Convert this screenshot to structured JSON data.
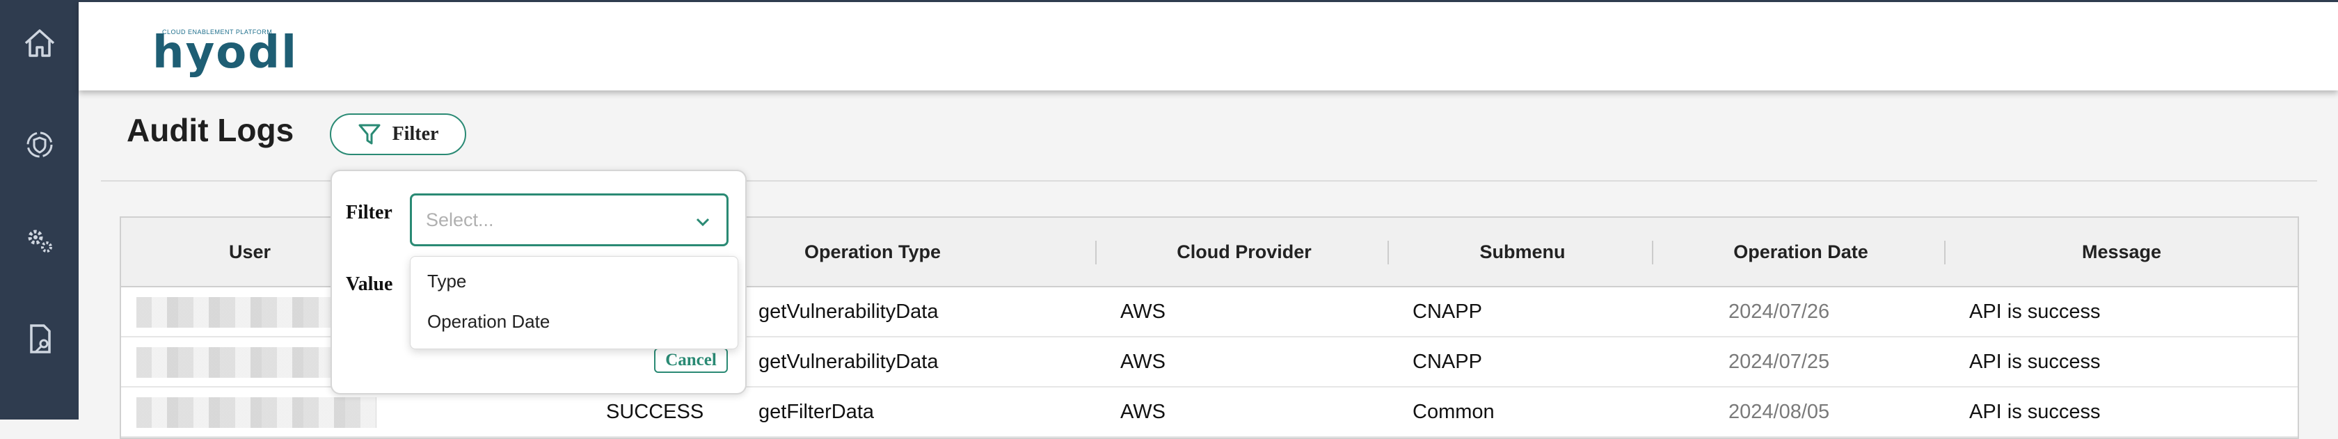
{
  "sidebar": {
    "items": [
      {
        "icon": "home-icon"
      },
      {
        "icon": "shield-icon"
      },
      {
        "icon": "gear-icon"
      },
      {
        "icon": "document-key-icon"
      }
    ]
  },
  "header": {
    "logo_tagline": "CLOUD ENABLEMENT PLATFORM",
    "logo_word": "hyodl"
  },
  "page": {
    "title": "Audit Logs",
    "filter_button": "Filter"
  },
  "table": {
    "columns": [
      "User",
      "Operation Type",
      "Cloud Provider",
      "Submenu",
      "Operation Date",
      "Message"
    ],
    "rows": [
      {
        "status": "",
        "operation_type": "getVulnerabilityData",
        "cloud_provider": "AWS",
        "submenu": "CNAPP",
        "operation_date": "2024/07/26",
        "message": "API is success"
      },
      {
        "status": "",
        "operation_type": "getVulnerabilityData",
        "cloud_provider": "AWS",
        "submenu": "CNAPP",
        "operation_date": "2024/07/25",
        "message": "API is success"
      },
      {
        "status": "SUCCESS",
        "operation_type": "getFilterData",
        "cloud_provider": "AWS",
        "submenu": "Common",
        "operation_date": "2024/08/05",
        "message": "API is success"
      }
    ]
  },
  "filter_popover": {
    "filter_label": "Filter",
    "value_label": "Value",
    "select_placeholder": "Select...",
    "options": [
      "Type",
      "Operation Date"
    ],
    "cancel_label": "Cancel"
  },
  "colors": {
    "accent": "#2a8a74",
    "sidebar": "#2f3c4f"
  }
}
